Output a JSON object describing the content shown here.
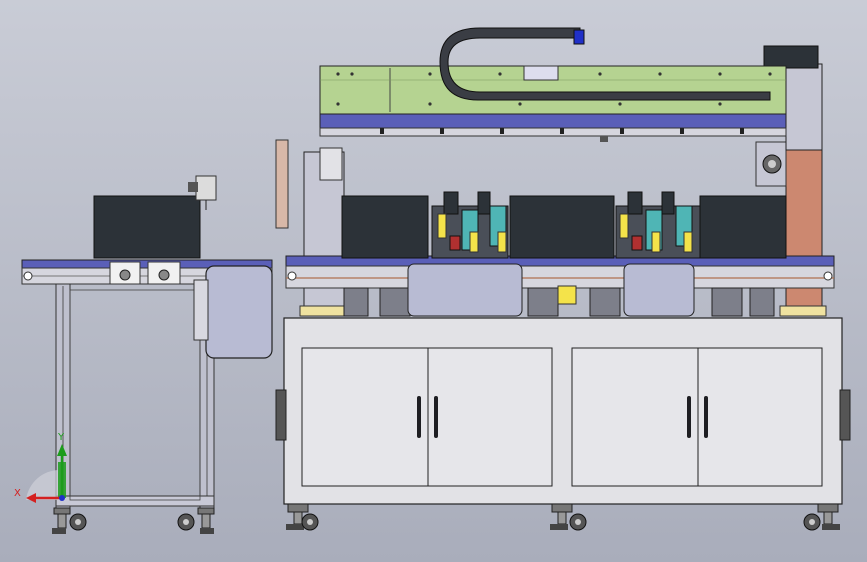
{
  "viewport": {
    "background_top": "#c9ccd6",
    "background_bottom": "#a9adbb"
  },
  "triad": {
    "x_label": "X",
    "y_label": "Y",
    "x_color": "#d42020",
    "y_color": "#1c9c1c",
    "z_color": "#2030c8"
  },
  "colors": {
    "gantry_green": "#b5d391",
    "rail_blue": "#5a5fb8",
    "body_grey": "#e2e2e6",
    "frame_grey": "#c6c7d4",
    "panel_lavender": "#b8bbd3",
    "dark_box": "#2c3238",
    "copper": "#cc8870",
    "teal": "#4fb5b5",
    "yellow": "#f4e34a"
  },
  "cabinet": {
    "doors": 4,
    "handles": 4
  }
}
